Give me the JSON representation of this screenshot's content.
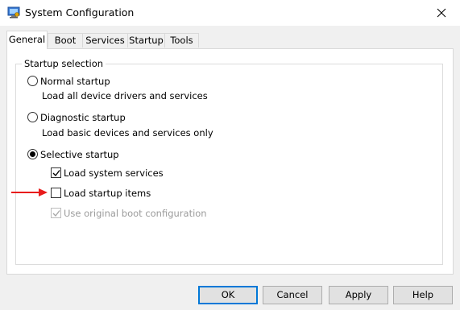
{
  "window": {
    "title": "System Configuration"
  },
  "tabs": [
    {
      "label": "General",
      "active": true
    },
    {
      "label": "Boot",
      "active": false
    },
    {
      "label": "Services",
      "active": false
    },
    {
      "label": "Startup",
      "active": false
    },
    {
      "label": "Tools",
      "active": false
    }
  ],
  "startup_selection": {
    "group_label": "Startup selection",
    "normal": {
      "label": "Normal startup",
      "description": "Load all device drivers and services",
      "selected": false
    },
    "diagnostic": {
      "label": "Diagnostic startup",
      "description": "Load basic devices and services only",
      "selected": false
    },
    "selective": {
      "label": "Selective startup",
      "selected": true,
      "options": {
        "load_system_services": {
          "label": "Load system services",
          "checked": true,
          "enabled": true
        },
        "load_startup_items": {
          "label": "Load startup items",
          "checked": false,
          "enabled": true
        },
        "use_original_boot_config": {
          "label": "Use original boot configuration",
          "checked": true,
          "enabled": false
        }
      }
    }
  },
  "buttons": {
    "ok": "OK",
    "cancel": "Cancel",
    "apply": "Apply",
    "help": "Help"
  },
  "annotation": {
    "arrow_color": "#e81b1b"
  },
  "colors": {
    "accent": "#0078d7"
  }
}
